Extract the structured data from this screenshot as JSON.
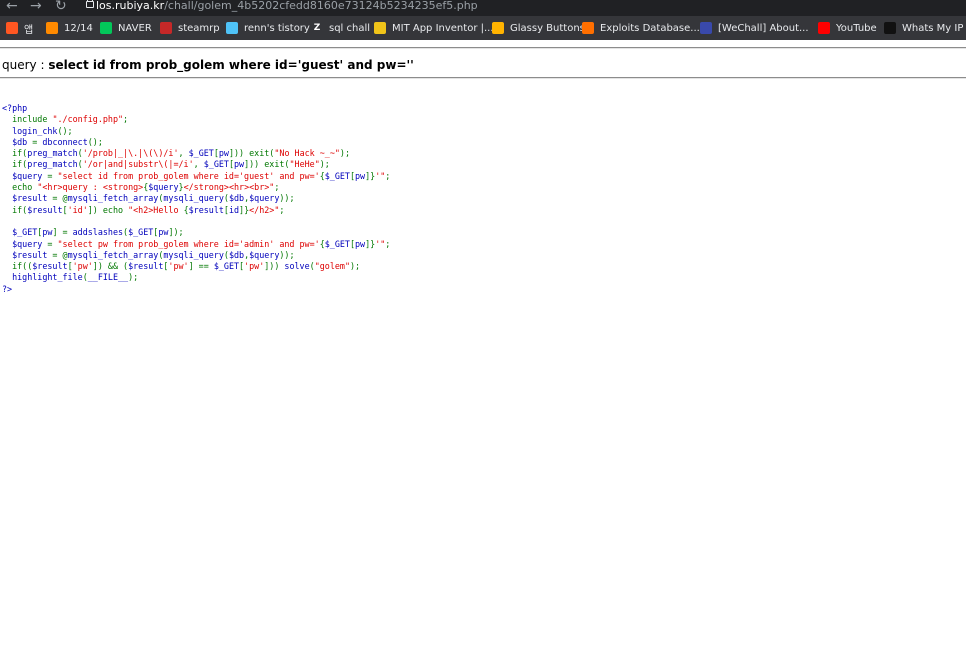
{
  "browser": {
    "url_host": "los.rubiya.kr",
    "url_path": "/chall/golem_4b5202cfedd8160e73124b5234235ef5.php",
    "bookmarks": [
      {
        "label": "앱",
        "icon": "apps-grid-icon",
        "color": "#ff5722"
      },
      {
        "label": "12/14",
        "icon": "blogger-icon",
        "color": "#ff8a00"
      },
      {
        "label": "NAVER",
        "icon": "naver-icon",
        "color": "#03c75a"
      },
      {
        "label": "steamrp",
        "icon": "steamrp-icon",
        "color": "#c62828"
      },
      {
        "label": "renn's tistory",
        "icon": "tistory-icon",
        "color": "#4fc3f7"
      },
      {
        "label": "sql chall",
        "icon": "z-icon",
        "color": "#ffffff"
      },
      {
        "label": "MIT App Inventor |...",
        "icon": "app-inventor-icon",
        "color": "#f0c419"
      },
      {
        "label": "Glassy Buttons",
        "icon": "glassy-buttons-icon",
        "color": "#ffb300"
      },
      {
        "label": "Exploits Database...",
        "icon": "exploit-db-icon",
        "color": "#ff6f00"
      },
      {
        "label": "[WeChall] About...",
        "icon": "wechall-icon",
        "color": "#3949ab"
      },
      {
        "label": "YouTube",
        "icon": "youtube-icon",
        "color": "#ff0000"
      },
      {
        "label": "Whats My IP Ad",
        "icon": "whatsmyip-icon",
        "color": "#111111"
      }
    ]
  },
  "page": {
    "query_prefix": "query : ",
    "query_sql": "select id from prob_golem where id='guest' and pw=''"
  },
  "source_code": {
    "lines": [
      [
        {
          "t": "<?php",
          "c": "d"
        }
      ],
      [
        {
          "t": "  ",
          "c": "d"
        },
        {
          "t": "include ",
          "c": "k"
        },
        {
          "t": "\"./config.php\"",
          "c": "s"
        },
        {
          "t": ";",
          "c": "k"
        }
      ],
      [
        {
          "t": "  login_chk",
          "c": "d"
        },
        {
          "t": "();",
          "c": "k"
        }
      ],
      [
        {
          "t": "  $db ",
          "c": "d"
        },
        {
          "t": "= ",
          "c": "k"
        },
        {
          "t": "dbconnect",
          "c": "d"
        },
        {
          "t": "();",
          "c": "k"
        }
      ],
      [
        {
          "t": "  ",
          "c": "d"
        },
        {
          "t": "if(",
          "c": "k"
        },
        {
          "t": "preg_match",
          "c": "d"
        },
        {
          "t": "(",
          "c": "k"
        },
        {
          "t": "'/prob|_|\\.|\\(\\)/i'",
          "c": "s"
        },
        {
          "t": ", ",
          "c": "k"
        },
        {
          "t": "$_GET",
          "c": "d"
        },
        {
          "t": "[",
          "c": "k"
        },
        {
          "t": "pw",
          "c": "d"
        },
        {
          "t": "])) exit(",
          "c": "k"
        },
        {
          "t": "\"No Hack ~_~\"",
          "c": "s"
        },
        {
          "t": ");",
          "c": "k"
        }
      ],
      [
        {
          "t": "  ",
          "c": "d"
        },
        {
          "t": "if(",
          "c": "k"
        },
        {
          "t": "preg_match",
          "c": "d"
        },
        {
          "t": "(",
          "c": "k"
        },
        {
          "t": "'/or|and|substr\\(|=/i'",
          "c": "s"
        },
        {
          "t": ", ",
          "c": "k"
        },
        {
          "t": "$_GET",
          "c": "d"
        },
        {
          "t": "[",
          "c": "k"
        },
        {
          "t": "pw",
          "c": "d"
        },
        {
          "t": "])) exit(",
          "c": "k"
        },
        {
          "t": "\"HeHe\"",
          "c": "s"
        },
        {
          "t": ");",
          "c": "k"
        }
      ],
      [
        {
          "t": "  $query ",
          "c": "d"
        },
        {
          "t": "= ",
          "c": "k"
        },
        {
          "t": "\"select id from prob_golem where id='guest' and pw='",
          "c": "s"
        },
        {
          "t": "{",
          "c": "k"
        },
        {
          "t": "$_GET",
          "c": "d"
        },
        {
          "t": "[",
          "c": "k"
        },
        {
          "t": "pw",
          "c": "d"
        },
        {
          "t": "]}",
          "c": "k"
        },
        {
          "t": "'\"",
          "c": "s"
        },
        {
          "t": ";",
          "c": "k"
        }
      ],
      [
        {
          "t": "  ",
          "c": "d"
        },
        {
          "t": "echo ",
          "c": "k"
        },
        {
          "t": "\"<hr>query : <strong>",
          "c": "s"
        },
        {
          "t": "{",
          "c": "k"
        },
        {
          "t": "$query",
          "c": "d"
        },
        {
          "t": "}",
          "c": "k"
        },
        {
          "t": "</strong><hr><br>\"",
          "c": "s"
        },
        {
          "t": ";",
          "c": "k"
        }
      ],
      [
        {
          "t": "  $result ",
          "c": "d"
        },
        {
          "t": "= @",
          "c": "k"
        },
        {
          "t": "mysqli_fetch_array",
          "c": "d"
        },
        {
          "t": "(",
          "c": "k"
        },
        {
          "t": "mysqli_query",
          "c": "d"
        },
        {
          "t": "(",
          "c": "k"
        },
        {
          "t": "$db",
          "c": "d"
        },
        {
          "t": ",",
          "c": "k"
        },
        {
          "t": "$query",
          "c": "d"
        },
        {
          "t": "));",
          "c": "k"
        }
      ],
      [
        {
          "t": "  ",
          "c": "d"
        },
        {
          "t": "if(",
          "c": "k"
        },
        {
          "t": "$result",
          "c": "d"
        },
        {
          "t": "[",
          "c": "k"
        },
        {
          "t": "'id'",
          "c": "s"
        },
        {
          "t": "]) echo ",
          "c": "k"
        },
        {
          "t": "\"<h2>Hello ",
          "c": "s"
        },
        {
          "t": "{",
          "c": "k"
        },
        {
          "t": "$result",
          "c": "d"
        },
        {
          "t": "[",
          "c": "k"
        },
        {
          "t": "id",
          "c": "d"
        },
        {
          "t": "]}",
          "c": "k"
        },
        {
          "t": "</h2>\"",
          "c": "s"
        },
        {
          "t": ";",
          "c": "k"
        }
      ],
      [
        {
          "t": "",
          "c": "h"
        }
      ],
      [
        {
          "t": "  $_GET",
          "c": "d"
        },
        {
          "t": "[",
          "c": "k"
        },
        {
          "t": "pw",
          "c": "d"
        },
        {
          "t": "] = ",
          "c": "k"
        },
        {
          "t": "addslashes",
          "c": "d"
        },
        {
          "t": "(",
          "c": "k"
        },
        {
          "t": "$_GET",
          "c": "d"
        },
        {
          "t": "[",
          "c": "k"
        },
        {
          "t": "pw",
          "c": "d"
        },
        {
          "t": "]);",
          "c": "k"
        }
      ],
      [
        {
          "t": "  $query ",
          "c": "d"
        },
        {
          "t": "= ",
          "c": "k"
        },
        {
          "t": "\"select pw from prob_golem where id='admin' and pw='",
          "c": "s"
        },
        {
          "t": "{",
          "c": "k"
        },
        {
          "t": "$_GET",
          "c": "d"
        },
        {
          "t": "[",
          "c": "k"
        },
        {
          "t": "pw",
          "c": "d"
        },
        {
          "t": "]}",
          "c": "k"
        },
        {
          "t": "'\"",
          "c": "s"
        },
        {
          "t": ";",
          "c": "k"
        }
      ],
      [
        {
          "t": "  $result ",
          "c": "d"
        },
        {
          "t": "= @",
          "c": "k"
        },
        {
          "t": "mysqli_fetch_array",
          "c": "d"
        },
        {
          "t": "(",
          "c": "k"
        },
        {
          "t": "mysqli_query",
          "c": "d"
        },
        {
          "t": "(",
          "c": "k"
        },
        {
          "t": "$db",
          "c": "d"
        },
        {
          "t": ",",
          "c": "k"
        },
        {
          "t": "$query",
          "c": "d"
        },
        {
          "t": "));",
          "c": "k"
        }
      ],
      [
        {
          "t": "  ",
          "c": "d"
        },
        {
          "t": "if((",
          "c": "k"
        },
        {
          "t": "$result",
          "c": "d"
        },
        {
          "t": "[",
          "c": "k"
        },
        {
          "t": "'pw'",
          "c": "s"
        },
        {
          "t": "]) && (",
          "c": "k"
        },
        {
          "t": "$result",
          "c": "d"
        },
        {
          "t": "[",
          "c": "k"
        },
        {
          "t": "'pw'",
          "c": "s"
        },
        {
          "t": "] == ",
          "c": "k"
        },
        {
          "t": "$_GET",
          "c": "d"
        },
        {
          "t": "[",
          "c": "k"
        },
        {
          "t": "'pw'",
          "c": "s"
        },
        {
          "t": "])) ",
          "c": "k"
        },
        {
          "t": "solve",
          "c": "d"
        },
        {
          "t": "(",
          "c": "k"
        },
        {
          "t": "\"golem\"",
          "c": "s"
        },
        {
          "t": ");",
          "c": "k"
        }
      ],
      [
        {
          "t": "  highlight_file",
          "c": "d"
        },
        {
          "t": "(",
          "c": "k"
        },
        {
          "t": "__FILE__",
          "c": "d"
        },
        {
          "t": ");",
          "c": "k"
        }
      ],
      [
        {
          "t": "?>",
          "c": "d"
        }
      ]
    ]
  }
}
